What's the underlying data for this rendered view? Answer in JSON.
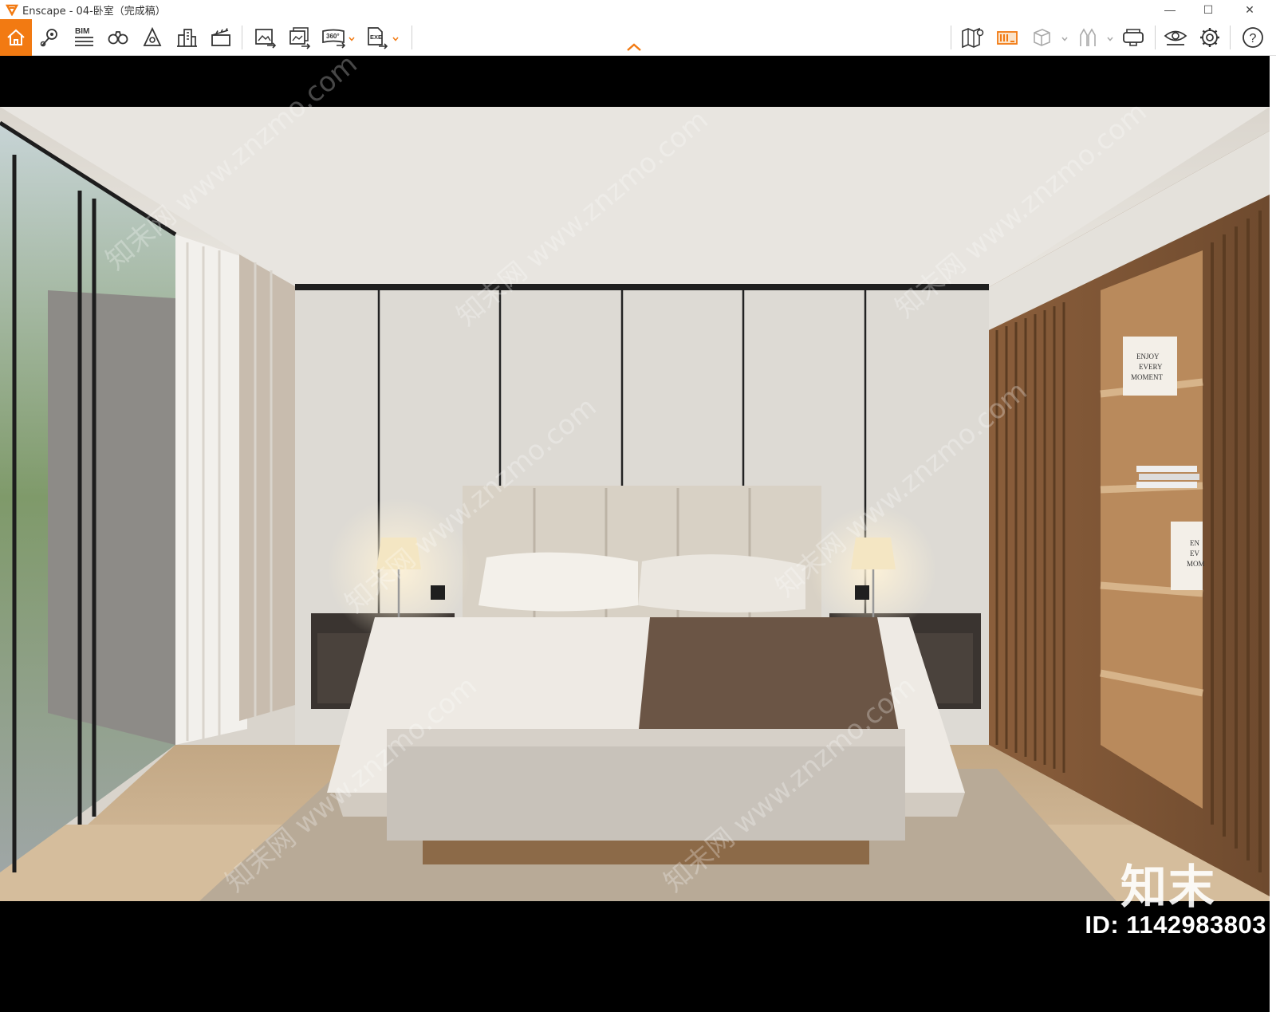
{
  "window": {
    "app_icon": "enscape-logo-icon",
    "title": "Enscape - 04-卧室（完成稿）",
    "minimize_glyph": "—",
    "maximize_glyph": "☐",
    "close_glyph": "✕"
  },
  "toolbar": {
    "left_tools": [
      {
        "name": "home",
        "icon": "home-icon"
      },
      {
        "name": "location",
        "icon": "map-pin-icon"
      },
      {
        "name": "bim",
        "icon": "bim-icon",
        "label": "BIM"
      },
      {
        "name": "binoculars",
        "icon": "binoculars-icon"
      },
      {
        "name": "light",
        "icon": "light-view-icon"
      },
      {
        "name": "buildings",
        "icon": "buildings-icon"
      },
      {
        "name": "clapper",
        "icon": "clapper-icon"
      },
      {
        "name": "export-image",
        "icon": "export-image-icon"
      },
      {
        "name": "batch-render",
        "icon": "batch-render-icon"
      },
      {
        "name": "panorama",
        "icon": "panorama-360-icon",
        "label": "360°"
      },
      {
        "name": "export-exe",
        "icon": "export-exe-icon",
        "label": "EXE"
      }
    ],
    "right_tools": [
      {
        "name": "map",
        "icon": "map-icon"
      },
      {
        "name": "asset-library",
        "icon": "asset-library-icon"
      },
      {
        "name": "cube",
        "icon": "cube-icon"
      },
      {
        "name": "vr",
        "icon": "vr-figure-icon"
      },
      {
        "name": "headset",
        "icon": "vr-headset-icon"
      },
      {
        "name": "visual-settings",
        "icon": "eye-icon"
      },
      {
        "name": "settings",
        "icon": "gear-icon"
      },
      {
        "name": "help",
        "icon": "help-icon",
        "label": "?"
      }
    ],
    "accent": "#f27a12"
  },
  "render": {
    "book_text": [
      "ENJOY",
      "EVERY",
      "MOMENT"
    ],
    "partial_book_text": [
      "EN",
      "EV",
      "MOM"
    ]
  },
  "watermark": {
    "logo_text": "知末",
    "id_text": "ID: 1142983803",
    "diag_text": "知末网 www.znzmo.com"
  }
}
